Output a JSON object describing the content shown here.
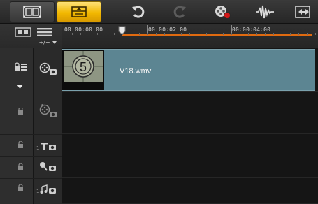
{
  "toolbar": {
    "storyboard_view": "film-strip-icon",
    "timeline_view": "timeline-view-icon",
    "undo": "undo-icon",
    "redo": "redo-icon",
    "record_capture": "record-capture-icon",
    "auto_music": "auto-music-icon",
    "fit_project": "fit-project-icon"
  },
  "header": {
    "add_remove_tracks": "+/−"
  },
  "ruler": {
    "timecodes": [
      "00:00:00:00",
      "00:00:02:00",
      "00:00:04:00"
    ]
  },
  "tracks": {
    "video": {
      "clip": {
        "name": "V18.wmv",
        "thumbnail_number": "5"
      }
    },
    "title_track_number": "1",
    "music_track_number": "1"
  },
  "colors": {
    "active_view": "#f2b800",
    "clip": "#5c8592",
    "work_area": "#e06a10",
    "playhead": "#7fc0ff"
  }
}
